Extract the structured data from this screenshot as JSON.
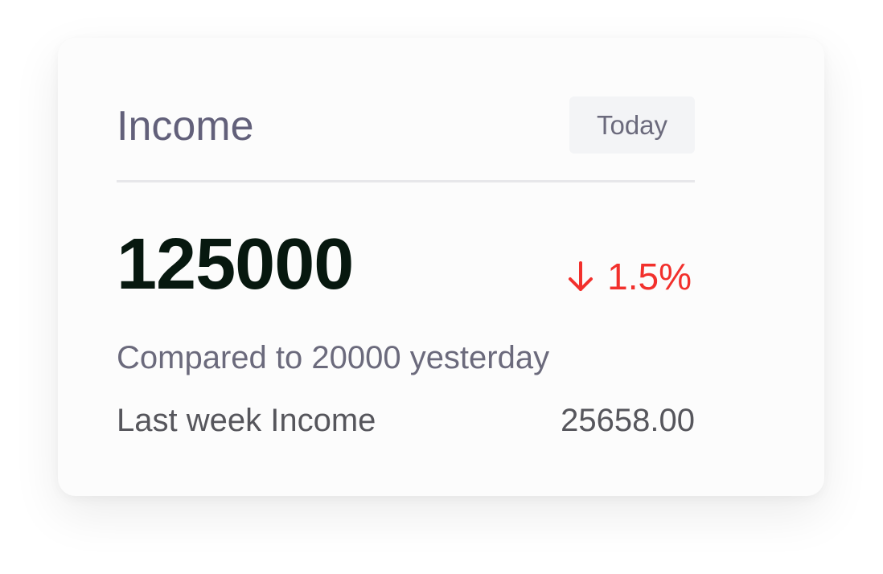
{
  "card": {
    "title": "Income",
    "period_button": "Today",
    "main_value": "125000",
    "change": {
      "direction": "down",
      "text": "1.5%",
      "color": "#f2302c"
    },
    "comparison_text": "Compared to 20000 yesterday",
    "last_week": {
      "label": "Last week Income",
      "value": "25658.00"
    }
  }
}
